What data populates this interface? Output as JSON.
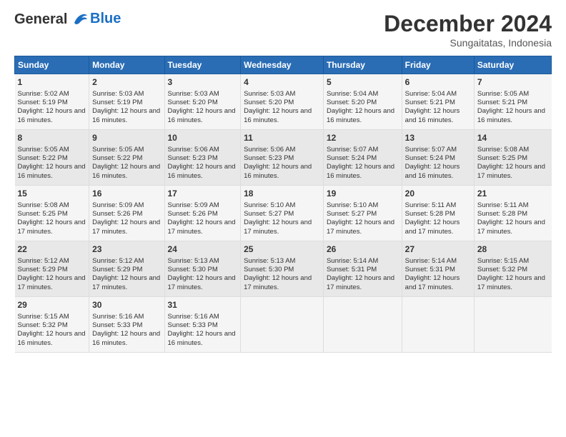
{
  "header": {
    "logo_line1": "General",
    "logo_line2": "Blue",
    "month": "December 2024",
    "location": "Sungaitatas, Indonesia"
  },
  "weekdays": [
    "Sunday",
    "Monday",
    "Tuesday",
    "Wednesday",
    "Thursday",
    "Friday",
    "Saturday"
  ],
  "weeks": [
    [
      {
        "day": "1",
        "sunrise": "5:02 AM",
        "sunset": "5:19 PM",
        "daylight": "12 hours and 16 minutes."
      },
      {
        "day": "2",
        "sunrise": "5:03 AM",
        "sunset": "5:19 PM",
        "daylight": "12 hours and 16 minutes."
      },
      {
        "day": "3",
        "sunrise": "5:03 AM",
        "sunset": "5:20 PM",
        "daylight": "12 hours and 16 minutes."
      },
      {
        "day": "4",
        "sunrise": "5:03 AM",
        "sunset": "5:20 PM",
        "daylight": "12 hours and 16 minutes."
      },
      {
        "day": "5",
        "sunrise": "5:04 AM",
        "sunset": "5:20 PM",
        "daylight": "12 hours and 16 minutes."
      },
      {
        "day": "6",
        "sunrise": "5:04 AM",
        "sunset": "5:21 PM",
        "daylight": "12 hours and 16 minutes."
      },
      {
        "day": "7",
        "sunrise": "5:05 AM",
        "sunset": "5:21 PM",
        "daylight": "12 hours and 16 minutes."
      }
    ],
    [
      {
        "day": "8",
        "sunrise": "5:05 AM",
        "sunset": "5:22 PM",
        "daylight": "12 hours and 16 minutes."
      },
      {
        "day": "9",
        "sunrise": "5:05 AM",
        "sunset": "5:22 PM",
        "daylight": "12 hours and 16 minutes."
      },
      {
        "day": "10",
        "sunrise": "5:06 AM",
        "sunset": "5:23 PM",
        "daylight": "12 hours and 16 minutes."
      },
      {
        "day": "11",
        "sunrise": "5:06 AM",
        "sunset": "5:23 PM",
        "daylight": "12 hours and 16 minutes."
      },
      {
        "day": "12",
        "sunrise": "5:07 AM",
        "sunset": "5:24 PM",
        "daylight": "12 hours and 16 minutes."
      },
      {
        "day": "13",
        "sunrise": "5:07 AM",
        "sunset": "5:24 PM",
        "daylight": "12 hours and 16 minutes."
      },
      {
        "day": "14",
        "sunrise": "5:08 AM",
        "sunset": "5:25 PM",
        "daylight": "12 hours and 17 minutes."
      }
    ],
    [
      {
        "day": "15",
        "sunrise": "5:08 AM",
        "sunset": "5:25 PM",
        "daylight": "12 hours and 17 minutes."
      },
      {
        "day": "16",
        "sunrise": "5:09 AM",
        "sunset": "5:26 PM",
        "daylight": "12 hours and 17 minutes."
      },
      {
        "day": "17",
        "sunrise": "5:09 AM",
        "sunset": "5:26 PM",
        "daylight": "12 hours and 17 minutes."
      },
      {
        "day": "18",
        "sunrise": "5:10 AM",
        "sunset": "5:27 PM",
        "daylight": "12 hours and 17 minutes."
      },
      {
        "day": "19",
        "sunrise": "5:10 AM",
        "sunset": "5:27 PM",
        "daylight": "12 hours and 17 minutes."
      },
      {
        "day": "20",
        "sunrise": "5:11 AM",
        "sunset": "5:28 PM",
        "daylight": "12 hours and 17 minutes."
      },
      {
        "day": "21",
        "sunrise": "5:11 AM",
        "sunset": "5:28 PM",
        "daylight": "12 hours and 17 minutes."
      }
    ],
    [
      {
        "day": "22",
        "sunrise": "5:12 AM",
        "sunset": "5:29 PM",
        "daylight": "12 hours and 17 minutes."
      },
      {
        "day": "23",
        "sunrise": "5:12 AM",
        "sunset": "5:29 PM",
        "daylight": "12 hours and 17 minutes."
      },
      {
        "day": "24",
        "sunrise": "5:13 AM",
        "sunset": "5:30 PM",
        "daylight": "12 hours and 17 minutes."
      },
      {
        "day": "25",
        "sunrise": "5:13 AM",
        "sunset": "5:30 PM",
        "daylight": "12 hours and 17 minutes."
      },
      {
        "day": "26",
        "sunrise": "5:14 AM",
        "sunset": "5:31 PM",
        "daylight": "12 hours and 17 minutes."
      },
      {
        "day": "27",
        "sunrise": "5:14 AM",
        "sunset": "5:31 PM",
        "daylight": "12 hours and 17 minutes."
      },
      {
        "day": "28",
        "sunrise": "5:15 AM",
        "sunset": "5:32 PM",
        "daylight": "12 hours and 17 minutes."
      }
    ],
    [
      {
        "day": "29",
        "sunrise": "5:15 AM",
        "sunset": "5:32 PM",
        "daylight": "12 hours and 16 minutes."
      },
      {
        "day": "30",
        "sunrise": "5:16 AM",
        "sunset": "5:33 PM",
        "daylight": "12 hours and 16 minutes."
      },
      {
        "day": "31",
        "sunrise": "5:16 AM",
        "sunset": "5:33 PM",
        "daylight": "12 hours and 16 minutes."
      },
      null,
      null,
      null,
      null
    ]
  ]
}
